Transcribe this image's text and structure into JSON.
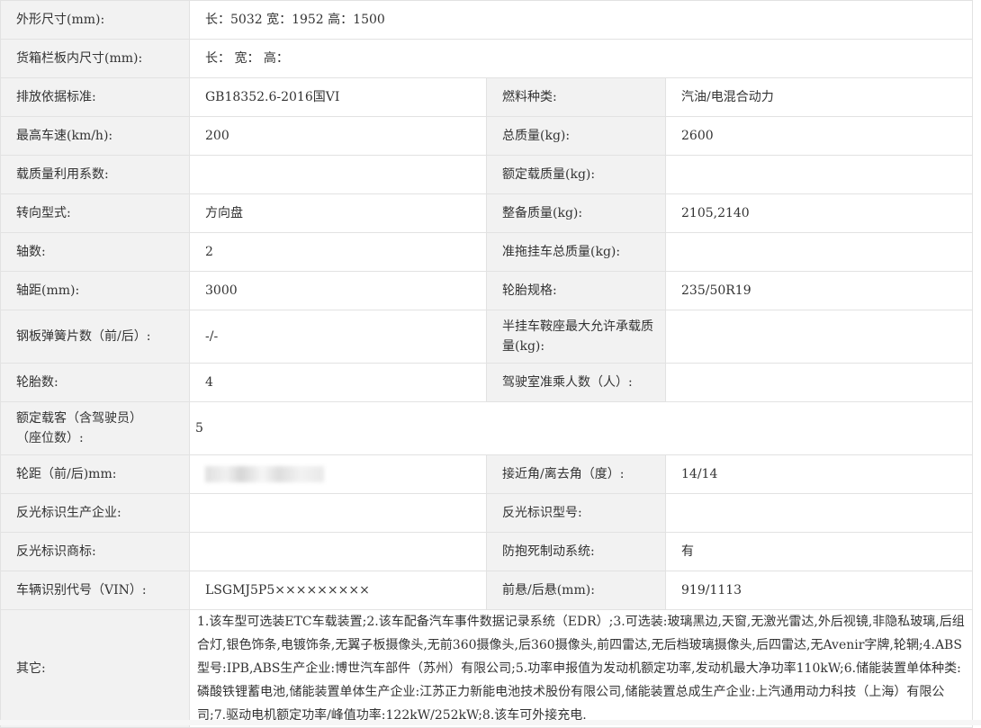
{
  "rows": {
    "dims": {
      "label": "外形尺寸(mm):",
      "value": "长：5032 宽：1952 高：1500"
    },
    "cargo_box": {
      "label": "货箱栏板内尺寸(mm):",
      "value": "长： 宽： 高："
    },
    "emission": {
      "label": "排放依据标准:",
      "value": "GB18352.6-2016国VI",
      "label2": "燃料种类:",
      "value2": "汽油/电混合动力"
    },
    "max_speed": {
      "label": "最高车速(km/h):",
      "value": "200",
      "label2": "总质量(kg):",
      "value2": "2600"
    },
    "load_factor": {
      "label": "载质量利用系数:",
      "value": "",
      "label2": "额定载质量(kg):",
      "value2": ""
    },
    "steering": {
      "label": "转向型式:",
      "value": "方向盘",
      "label2": "整备质量(kg):",
      "value2": "2105,2140"
    },
    "axles": {
      "label": "轴数:",
      "value": "2",
      "label2": "准拖挂车总质量(kg):",
      "value2": ""
    },
    "wheelbase": {
      "label": "轴距(mm):",
      "value": "3000",
      "label2": "轮胎规格:",
      "value2": "235/50R19"
    },
    "leaf_springs": {
      "label": "钢板弹簧片数（前/后）:",
      "value": "-/-",
      "label2": "半挂车鞍座最大允许承载质量(kg):",
      "value2": ""
    },
    "tires": {
      "label": "轮胎数:",
      "value": "4",
      "label2": "驾驶室准乘人数（人）:",
      "value2": ""
    },
    "seats": {
      "label": "额定载客（含驾驶员）（座位数）:",
      "value": "5"
    },
    "track": {
      "label": "轮距（前/后)mm:",
      "value": "",
      "label2": "接近角/离去角（度）:",
      "value2": "14/14"
    },
    "reflector_maker": {
      "label": "反光标识生产企业:",
      "value": "",
      "label2": "反光标识型号:",
      "value2": ""
    },
    "reflector_brand": {
      "label": "反光标识商标:",
      "value": "",
      "label2": "防抱死制动系统:",
      "value2": "有"
    },
    "vin": {
      "label": "车辆识别代号（VIN）:",
      "value": "LSGMJ5P5×××××××××",
      "label2": "前悬/后悬(mm):",
      "value2": "919/1113"
    },
    "other": {
      "label": "其它:",
      "value": "1.该车型可选装ETC车载装置;2.该车配备汽车事件数据记录系统（EDR）;3.可选装:玻璃黑边,天窗,无激光雷达,外后视镜,非隐私玻璃,后组合灯,银色饰条,电镀饰条,无翼子板摄像头,无前360摄像头,后360摄像头,前四雷达,无后档玻璃摄像头,后四雷达,无Avenir字牌,轮辋;4.ABS型号:IPB,ABS生产企业:博世汽车部件（苏州）有限公司;5.功率申报值为发动机额定功率,发动机最大净功率110kW;6.储能装置单体种类:磷酸铁锂蓄电池,储能装置单体生产企业:江苏正力新能电池技术股份有限公司,储能装置总成生产企业:上汽通用动力科技（上海）有限公司;7.驱动电机额定功率/峰值功率:122kW/252kW;8.该车可外接充电."
    }
  }
}
